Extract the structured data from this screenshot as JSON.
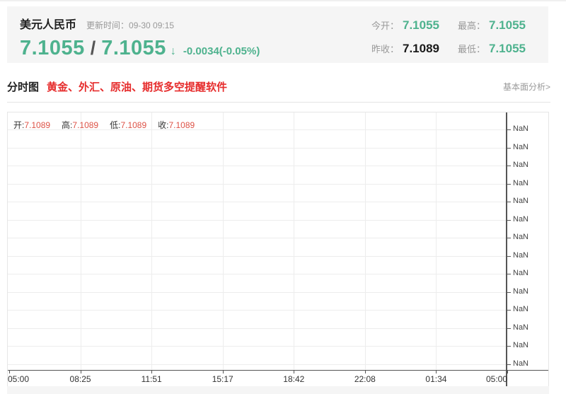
{
  "colors": {
    "green": "#4eb28e",
    "red_promo": "#e62c2c",
    "red_value": "#dd5246",
    "dark_text": "#222222",
    "gray_text": "#999999",
    "axis": "#555555",
    "grid": "#ededed",
    "panel_bg": "#f5f5f5"
  },
  "header": {
    "title": "美元人民币",
    "update_label": "更新时间：",
    "update_time": "09-30 09:15",
    "bid": "7.1055",
    "slash": "/",
    "ask": "7.1055",
    "arrow": "↓",
    "change": "-0.0034(-0.05%)"
  },
  "stats": [
    {
      "label": "今开：",
      "value": "7.1055"
    },
    {
      "label": "最高：",
      "value": "7.1055"
    },
    {
      "label": "昨收：",
      "value": "7.1089"
    },
    {
      "label": "最低：",
      "value": "7.1055"
    }
  ],
  "section": {
    "title": "分时图",
    "promo": "黄金、外汇、原油、期货多空提醒软件",
    "analysis_link": "基本面分析>"
  },
  "chart_data": {
    "type": "line",
    "title": "分时图 美元人民币",
    "series": [
      {
        "name": "美元人民币",
        "values": []
      }
    ],
    "note": "no data plotted; y-axis shows NaN placeholders",
    "x_ticks": [
      "05:00",
      "08:25",
      "11:51",
      "15:17",
      "18:42",
      "22:08",
      "01:34",
      "05:00"
    ],
    "y_ticks": [
      "NaN",
      "NaN",
      "NaN",
      "NaN",
      "NaN",
      "NaN",
      "NaN",
      "NaN",
      "NaN",
      "NaN",
      "NaN",
      "NaN",
      "NaN",
      "NaN"
    ],
    "y_axis_side": "right",
    "grid": true,
    "legend_position": "top-left",
    "ohlc": [
      {
        "key": "open",
        "label": "开:",
        "value": "7.1089"
      },
      {
        "key": "high",
        "label": "高:",
        "value": "7.1089"
      },
      {
        "key": "low",
        "label": "低:",
        "value": "7.1089"
      },
      {
        "key": "close",
        "label": "收:",
        "value": "7.1089"
      }
    ]
  }
}
